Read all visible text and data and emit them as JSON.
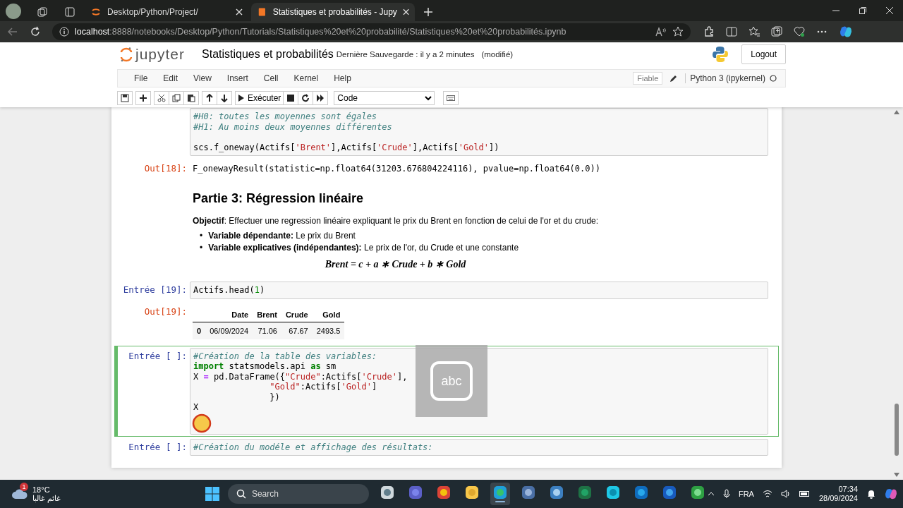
{
  "browser": {
    "tabs": [
      {
        "title": "Desktop/Python/Project/",
        "kind": "jupyter",
        "selected": false
      },
      {
        "title": "Statistiques et probabilités - Jupy",
        "kind": "notebook",
        "selected": true
      }
    ],
    "url_host": "localhost",
    "url_path": ":8888/notebooks/Desktop/Python/Tutorials/Statistiques%20et%20probabilité/Statistiques%20et%20probabilités.ipynb"
  },
  "header": {
    "logo_text": "jupyter",
    "title": "Statistiques et probabilités",
    "save_status": "Dernière Sauvegarde : il y a 2 minutes",
    "modified": "(modifié)",
    "logout": "Logout"
  },
  "menu": [
    "File",
    "Edit",
    "View",
    "Insert",
    "Cell",
    "Kernel",
    "Help"
  ],
  "trusted": "Fiable",
  "kernel": "Python 3 (ipykernel)",
  "toolbar": {
    "run": "Exécuter",
    "cell_type": "Code"
  },
  "cells": [
    {
      "kind": "code",
      "selected": false,
      "lines": [
        [
          {
            "kind": "comment",
            "text": "#H0: toutes les moyennes sont égales"
          }
        ],
        [
          {
            "kind": "comment",
            "text": "#H1: Au moins deux moyennes différentes"
          }
        ],
        [
          {
            "kind": "blank"
          }
        ],
        [
          {
            "kind": "plain",
            "text": "scs.f_oneway(Actifs["
          },
          {
            "kind": "string",
            "text": "'Brent'"
          },
          {
            "kind": "plain",
            "text": "],Actifs["
          },
          {
            "kind": "string",
            "text": "'Crude'"
          },
          {
            "kind": "plain",
            "text": "],Actifs["
          },
          {
            "kind": "string",
            "text": "'Gold'"
          },
          {
            "kind": "plain",
            "text": "])"
          }
        ]
      ]
    },
    {
      "kind": "output",
      "prompt": "Out[18]:",
      "text": "F_onewayResult(statistic=np.float64(31203.676804224116), pvalue=np.float64(0.0))"
    },
    {
      "kind": "markdown",
      "heading": "Partie 3: Régression linéaire",
      "paragraph": "**Objectif**: Effectuer une regression linéaire expliquant le prix du Brent en fonction de celui de l'or et du crude:",
      "bullets": [
        {
          "marker": "•",
          "text": "**Variable dépendante:** Le prix du Brent"
        },
        {
          "marker": "•",
          "text": "**Variable explicatives (indépendantes):** Le prix de l'or, du Crude et une constante"
        }
      ],
      "formula": "Brent = c + a ∗ Crude + b ∗ Gold"
    },
    {
      "kind": "code",
      "prompt": "Entrée [19]:",
      "selected": false,
      "lines": [
        [
          {
            "kind": "plain",
            "text": "Actifs.head("
          },
          {
            "kind": "number",
            "text": "1"
          },
          {
            "kind": "plain",
            "text": ")"
          }
        ]
      ]
    },
    {
      "kind": "table",
      "prompt": "Out[19]:",
      "columns": [
        "Date",
        "Brent",
        "Crude",
        "Gold"
      ],
      "rows": [
        {
          "index": "0",
          "cells": [
            "06/09/2024",
            "71.06",
            "67.67",
            "2493.5"
          ]
        }
      ]
    },
    {
      "kind": "code",
      "prompt": "Entrée [ ]:",
      "selected": true,
      "lines": [
        [
          {
            "kind": "comment",
            "text": "#Création de la table des variables:"
          }
        ],
        [
          {
            "kind": "keyword",
            "text": "import"
          },
          {
            "kind": "plain",
            "text": " statsmodels.api "
          },
          {
            "kind": "keyword",
            "text": "as"
          },
          {
            "kind": "plain",
            "text": " sm"
          }
        ],
        [
          {
            "kind": "plain",
            "text": "X "
          },
          {
            "kind": "operator",
            "text": "="
          },
          {
            "kind": "plain",
            "text": " pd.DataFrame({"
          },
          {
            "kind": "string",
            "text": "\"Crude\""
          },
          {
            "kind": "plain",
            "text": ":Actifs["
          },
          {
            "kind": "string",
            "text": "'Crude'"
          },
          {
            "kind": "plain",
            "text": "],"
          }
        ],
        [
          {
            "kind": "string",
            "text": "               \"Gold\""
          },
          {
            "kind": "plain",
            "text": ":Actifs["
          },
          {
            "kind": "string",
            "text": "'Gold'"
          },
          {
            "kind": "plain",
            "text": "]"
          }
        ],
        [
          {
            "kind": "plain",
            "text": "               })"
          }
        ],
        [
          {
            "kind": "plain",
            "text": "X"
          }
        ]
      ]
    },
    {
      "kind": "code",
      "prompt": "Entrée [ ]:",
      "selected": false,
      "lines": [
        [
          {
            "kind": "comment",
            "text": "#Création du modéle et affichage des résultats:"
          }
        ]
      ]
    }
  ],
  "overlay": {
    "label": "abc"
  },
  "taskbar": {
    "weather": {
      "temp": "18°C",
      "text": "غائم غالبا",
      "badge": "1"
    },
    "search": "Search",
    "apps": [
      {
        "kind": "taskview",
        "selected": false
      },
      {
        "kind": "teams",
        "selected": false
      },
      {
        "kind": "chrome",
        "selected": false
      },
      {
        "kind": "files",
        "selected": false
      },
      {
        "kind": "edge",
        "selected": true
      },
      {
        "kind": "r",
        "selected": false
      },
      {
        "kind": "globe",
        "selected": false
      },
      {
        "kind": "excel",
        "selected": false
      },
      {
        "kind": "ring",
        "selected": false
      },
      {
        "kind": "outlook",
        "selected": false
      },
      {
        "kind": "word",
        "selected": false
      },
      {
        "kind": "spinner",
        "selected": false
      }
    ],
    "lang": "FRA",
    "time": "07:34",
    "date": "28/09/2024"
  }
}
